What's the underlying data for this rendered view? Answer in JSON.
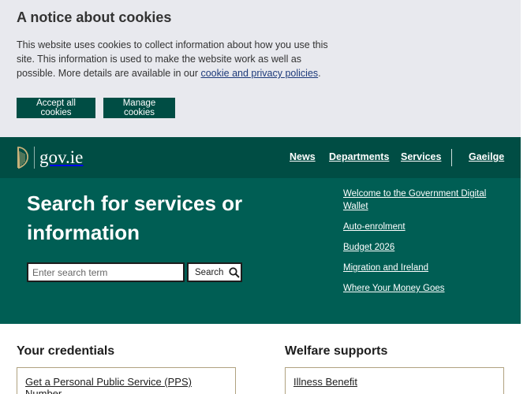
{
  "cookie_banner": {
    "title": "A notice about cookies",
    "text": "This website uses cookies to collect information about how you use this site. This information is used to make the website work as well as possible. More details are available in our ",
    "link_text": "cookie and privacy policies",
    "text_end": ".",
    "accept_label": "Accept all cookies",
    "manage_label": "Manage cookies"
  },
  "header": {
    "logo_text": "gov.ie",
    "nav": [
      "News",
      "Departments",
      "Services",
      "Gaeilge"
    ]
  },
  "hero": {
    "title": "Search for services or information",
    "search_placeholder": "Enter search term",
    "search_button": "Search",
    "links": [
      "Welcome to the Government Digital Wallet",
      "Auto-enrolment",
      "Budget 2026",
      "Migration and Ireland",
      "Where Your Money Goes"
    ]
  },
  "sections": [
    {
      "title": "Your credentials",
      "first_item": "Get a Personal Public Service (PPS) Number"
    },
    {
      "title": "Welfare supports",
      "first_item": "Illness Benefit"
    }
  ],
  "colors": {
    "banner_bg": "#e8e9ee",
    "header_bg": "#004d44",
    "hero_bg": "#005e54",
    "button_bg": "#004d44",
    "card_border": "#b0a280"
  }
}
